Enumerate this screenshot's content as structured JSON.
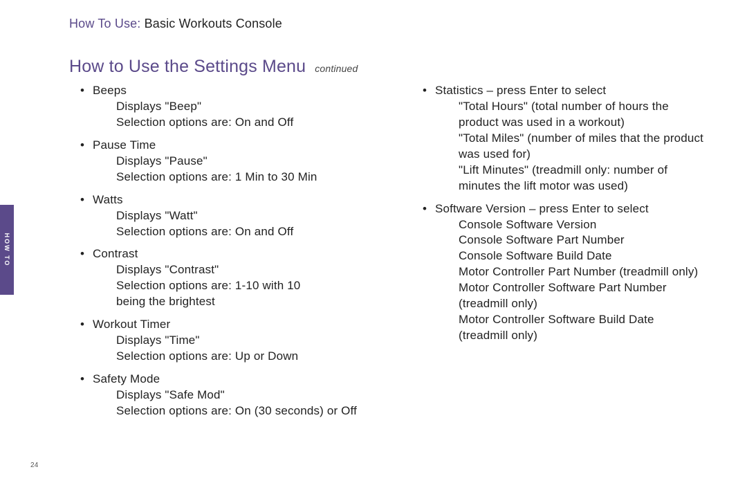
{
  "kicker": {
    "lead": "How To Use:",
    "tail": " Basic Workouts Console"
  },
  "title": "How to Use the Settings Menu",
  "title_cont": "continued",
  "sidebar_label": "HOW TO",
  "page_number": "24",
  "left": [
    {
      "head": "Beeps",
      "lines": [
        "Displays \"Beep\"",
        "Selection options are: On and Off"
      ]
    },
    {
      "head": "Pause Time",
      "lines": [
        "Displays  \"Pause\"",
        "Selection options are: 1 Min to 30 Min"
      ]
    },
    {
      "head": "Watts",
      "lines": [
        "Displays \"Watt\"",
        "Selection options are: On and Off"
      ]
    },
    {
      "head": " Contrast",
      "lines": [
        "Displays  \"Contrast\"",
        "Selection options are: 1-10 with 10",
        "being the brightest"
      ]
    },
    {
      "head": " Workout Timer",
      "lines": [
        "Displays \"Time\"",
        "Selection options are: Up or Down"
      ]
    },
    {
      "head": " Safety Mode",
      "lines": [
        "Displays \"Safe Mod\"",
        "Selection options are: On (30 seconds) or Off"
      ]
    }
  ],
  "right": [
    {
      "head": " Statistics – press Enter to select",
      "lines": [
        "\"Total Hours\" (total number of hours the",
        "product was used in a workout)",
        "\"Total Miles\" (number of miles that the product",
        "was used for)",
        "\"Lift Minutes\"  (treadmill only: number of",
        "minutes the lift motor was used)"
      ]
    },
    {
      "head": " Software Version – press Enter to select",
      "lines": [
        "Console Software Version",
        "Console Software Part Number",
        "Console Software Build Date",
        "Motor Controller Part Number (treadmill only)",
        "Motor Controller Software Part Number",
        "(treadmill only)",
        "Motor Controller Software Build Date",
        "(treadmill only)"
      ]
    }
  ]
}
